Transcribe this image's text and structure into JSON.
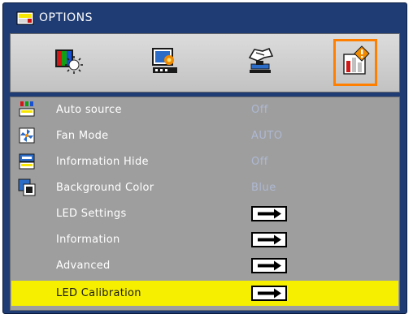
{
  "window": {
    "title": "OPTIONS"
  },
  "tabs": [
    {
      "icon": "image-settings-icon",
      "selected": false
    },
    {
      "icon": "screen-settings-icon",
      "selected": false
    },
    {
      "icon": "setup-settings-icon",
      "selected": false
    },
    {
      "icon": "options-settings-icon",
      "selected": true
    }
  ],
  "menu": {
    "items": [
      {
        "label": "Auto source",
        "value": "Off",
        "icon": "auto-source-icon"
      },
      {
        "label": "Fan Mode",
        "value": "AUTO",
        "icon": "fan-mode-icon"
      },
      {
        "label": "Information Hide",
        "value": "Off",
        "icon": "information-hide-icon"
      },
      {
        "label": "Background Color",
        "value": "Blue",
        "icon": "background-color-icon"
      },
      {
        "label": "LED Settings",
        "submenu": true
      },
      {
        "label": "Information",
        "submenu": true
      },
      {
        "label": "Advanced",
        "submenu": true
      },
      {
        "label": "LED Calibration",
        "submenu": true,
        "highlighted": true
      }
    ]
  },
  "colors": {
    "panel_bg": "#1f3c74",
    "list_bg": "#9e9e9e",
    "highlight": "#f6ef00",
    "selected_tab_border": "#ff7f00",
    "value_text": "#aeb8d2"
  }
}
